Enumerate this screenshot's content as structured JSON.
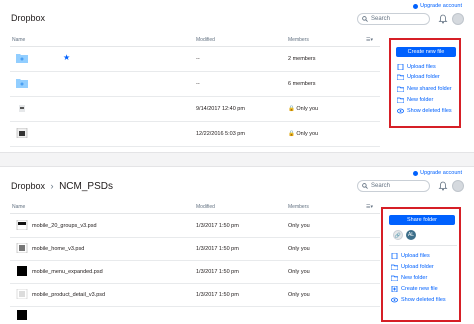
{
  "top": {
    "upgrade": "Upgrade account",
    "title": "Dropbox",
    "search_placeholder": "Search",
    "columns": {
      "name": "Name",
      "modified": "Modified",
      "members": "Members"
    },
    "rows": [
      {
        "modified": "--",
        "members": "2 members",
        "starred": true,
        "icon": "shared-folder-icon"
      },
      {
        "modified": "--",
        "members": "6 members",
        "starred": false,
        "icon": "shared-folder-icon"
      },
      {
        "modified": "9/14/2017 12:40 pm",
        "members": "Only you",
        "starred": false,
        "icon": "file-icon"
      },
      {
        "modified": "12/22/2016 5:03 pm",
        "members": "Only you",
        "starred": false,
        "icon": "image-file-icon"
      }
    ],
    "actions": {
      "primary": "Create new file",
      "items": [
        "Upload files",
        "Upload folder",
        "New shared folder",
        "New folder",
        "Show deleted files"
      ]
    }
  },
  "bottom": {
    "upgrade": "Upgrade account",
    "crumb_root": "Dropbox",
    "crumb_sep": "›",
    "crumb_current": "NCM_PSDs",
    "search_placeholder": "Search",
    "columns": {
      "name": "Name",
      "modified": "Modified",
      "members": "Members"
    },
    "rows": [
      {
        "name": "mobile_20_groups_v3.psd",
        "modified": "1/3/2017 1:50 pm",
        "members": "Only you"
      },
      {
        "name": "mobile_home_v3.psd",
        "modified": "1/3/2017 1:50 pm",
        "members": "Only you"
      },
      {
        "name": "mobile_menu_expanded.psd",
        "modified": "1/3/2017 1:50 pm",
        "members": "Only you"
      },
      {
        "name": "mobile_product_detail_v3.psd",
        "modified": "1/3/2017 1:50 pm",
        "members": "Only you"
      }
    ],
    "actions": {
      "primary": "Share folder",
      "member_initials": "AL",
      "items": [
        "Upload files",
        "Upload folder",
        "New folder",
        "Create new file",
        "Show deleted files"
      ]
    }
  },
  "colors": {
    "accent": "#0061fe",
    "highlight": "#d61f26"
  }
}
